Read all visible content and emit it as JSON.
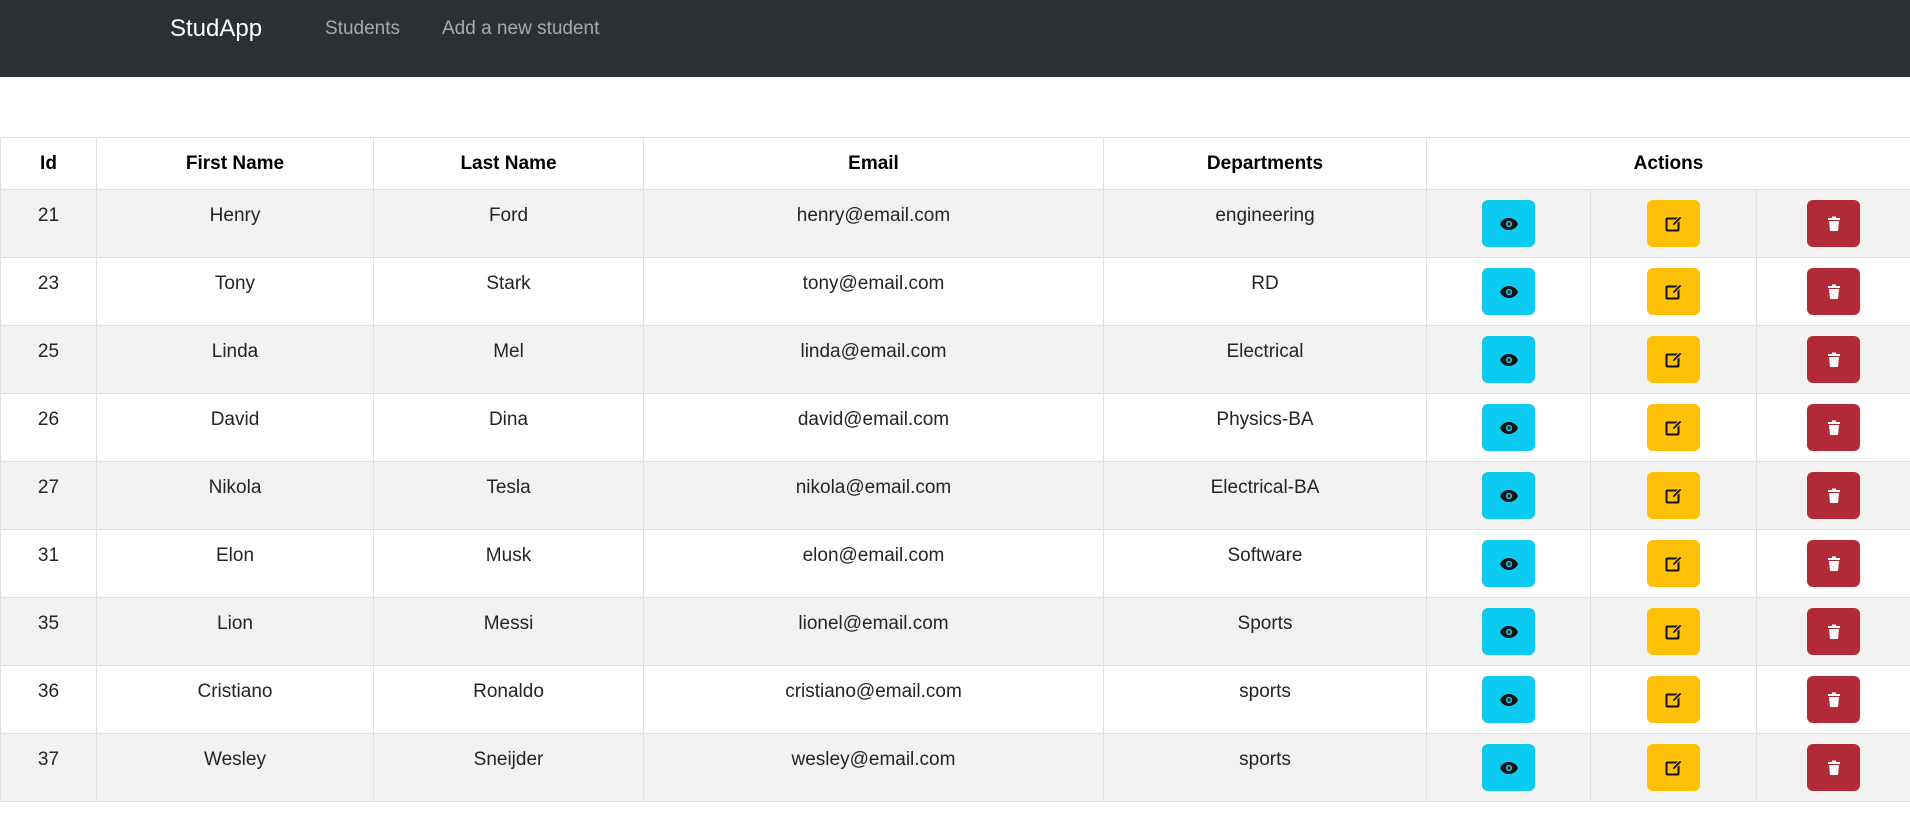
{
  "navbar": {
    "brand": "StudApp",
    "links": [
      "Students",
      "Add a new student"
    ]
  },
  "table": {
    "headers": {
      "id": "Id",
      "first_name": "First Name",
      "last_name": "Last Name",
      "email": "Email",
      "departments": "Departments",
      "actions": "Actions"
    },
    "rows": [
      {
        "id": "21",
        "first_name": "Henry",
        "last_name": "Ford",
        "email": "henry@email.com",
        "department": "engineering"
      },
      {
        "id": "23",
        "first_name": "Tony",
        "last_name": "Stark",
        "email": "tony@email.com",
        "department": "RD"
      },
      {
        "id": "25",
        "first_name": "Linda",
        "last_name": "Mel",
        "email": "linda@email.com",
        "department": "Electrical"
      },
      {
        "id": "26",
        "first_name": "David",
        "last_name": "Dina",
        "email": "david@email.com",
        "department": "Physics-BA"
      },
      {
        "id": "27",
        "first_name": "Nikola",
        "last_name": "Tesla",
        "email": "nikola@email.com",
        "department": "Electrical-BA"
      },
      {
        "id": "31",
        "first_name": "Elon",
        "last_name": "Musk",
        "email": "elon@email.com",
        "department": "Software"
      },
      {
        "id": "35",
        "first_name": "Lion",
        "last_name": "Messi",
        "email": "lionel@email.com",
        "department": "Sports"
      },
      {
        "id": "36",
        "first_name": "Cristiano",
        "last_name": "Ronaldo",
        "email": "cristiano@email.com",
        "department": "sports"
      },
      {
        "id": "37",
        "first_name": "Wesley",
        "last_name": "Sneijder",
        "email": "wesley@email.com",
        "department": "sports"
      }
    ],
    "action_icons": [
      "eye-icon",
      "edit-icon",
      "trash-icon"
    ]
  },
  "colors": {
    "navbar_bg": "#2b3035",
    "view_button": "#0dcaf0",
    "edit_button": "#ffc107",
    "delete_button": "#b02a37",
    "striped_row": "#f2f2f2"
  }
}
